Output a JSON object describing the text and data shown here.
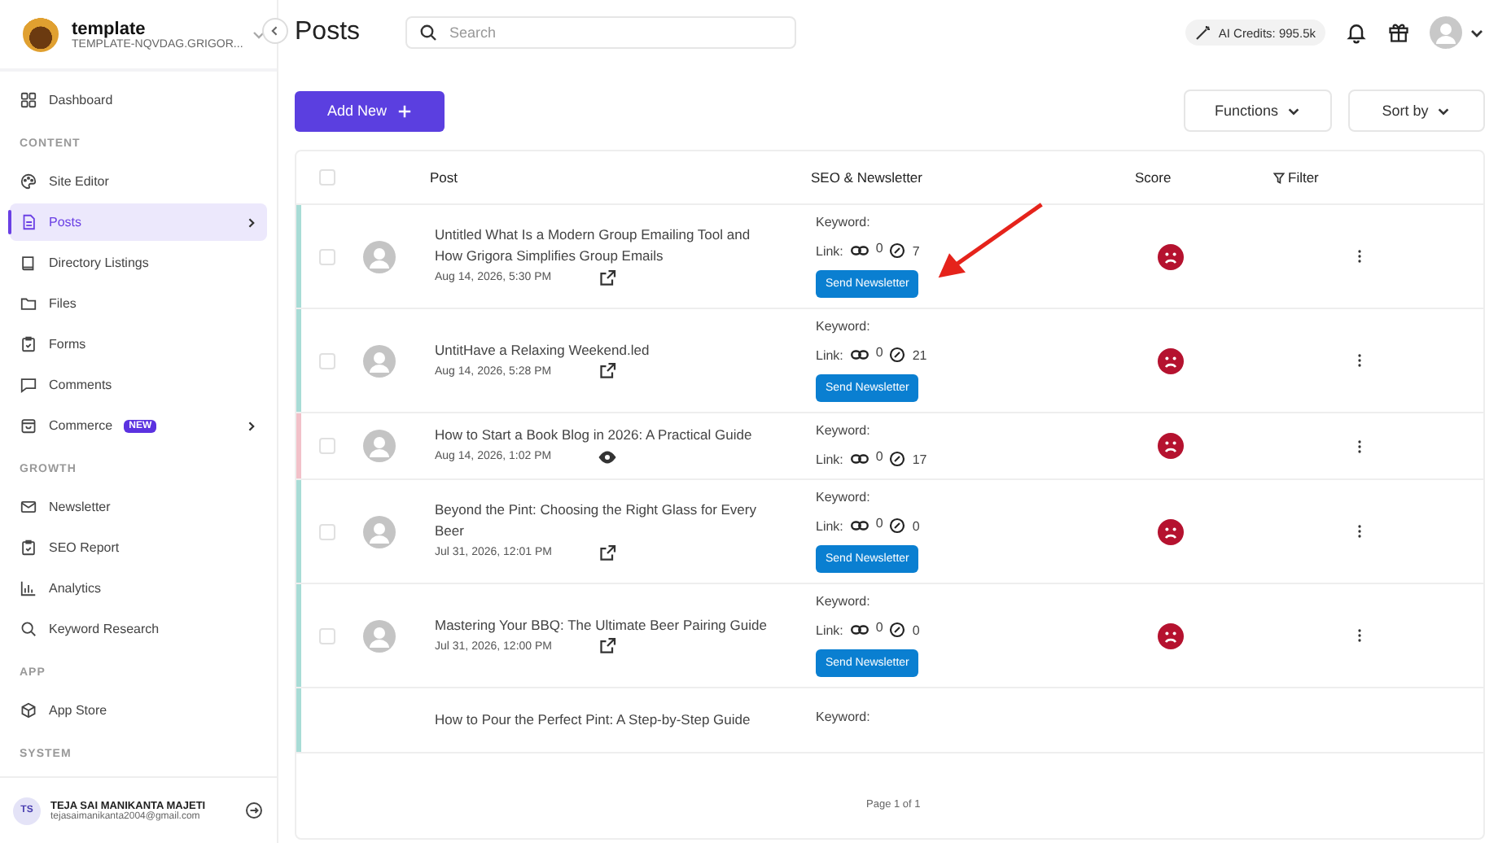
{
  "workspace": {
    "name": "template",
    "domain": "TEMPLATE-NQVDAG.GRIGOR..."
  },
  "sidebar": {
    "sections": [
      {
        "items": [
          {
            "label": "Dashboard",
            "selected": false
          }
        ]
      },
      {
        "heading": "CONTENT",
        "items": [
          {
            "label": "Site Editor",
            "selected": false
          },
          {
            "label": "Posts",
            "selected": true,
            "chevron": true
          },
          {
            "label": "Directory Listings",
            "selected": false
          },
          {
            "label": "Files",
            "selected": false
          },
          {
            "label": "Forms",
            "selected": false
          },
          {
            "label": "Comments",
            "selected": false
          },
          {
            "label": "Commerce",
            "selected": false,
            "badge": "NEW",
            "chevron": true
          }
        ]
      },
      {
        "heading": "GROWTH",
        "items": [
          {
            "label": "Newsletter",
            "selected": false
          },
          {
            "label": "SEO Report",
            "selected": false
          },
          {
            "label": "Analytics",
            "selected": false
          },
          {
            "label": "Keyword Research",
            "selected": false
          }
        ]
      },
      {
        "heading": "APP",
        "items": [
          {
            "label": "App Store",
            "selected": false
          }
        ]
      },
      {
        "heading": "SYSTEM"
      }
    ]
  },
  "user": {
    "initials": "TS",
    "name": "TEJA SAI MANIKANTA MAJETI",
    "email": "tejasaimanikanta2004@gmail.com"
  },
  "header": {
    "title": "Posts",
    "search": {
      "placeholder": "Search"
    },
    "credits": "AI Credits: 995.5k"
  },
  "toolbar": {
    "add_button": "Add New",
    "buttons": [
      "Functions",
      "Sort by"
    ]
  },
  "table": {
    "select_all_checked": false,
    "columns": [
      "Post",
      "SEO & Newsletter",
      "Score",
      "Filter"
    ],
    "rows": [
      {
        "title": "Untitled What Is a Modern Group Emailing Tool and How Grigora Simplifies Group Emails",
        "date": "Aug 14, 2026, 5:30 PM",
        "kind": "external",
        "color": "#a8dcd6",
        "checked": false,
        "keyword": "Keyword:",
        "link_label": "Link:",
        "links": "0",
        "score_count": "7",
        "newsletter": "Send Newsletter"
      },
      {
        "title": "UntitHave a Relaxing Weekend.led",
        "date": "Aug 14, 2026, 5:28 PM",
        "kind": "external",
        "color": "#a8dcd6",
        "checked": false,
        "keyword": "Keyword:",
        "link_label": "Link:",
        "links": "0",
        "score_count": "21",
        "newsletter": "Send Newsletter"
      },
      {
        "title": "How to Start a Book Blog in 2026: A Practical Guide",
        "date": "Aug 14, 2026, 1:02 PM",
        "kind": "view",
        "color": "#f2c1c9",
        "checked": false,
        "keyword": "Keyword:",
        "link_label": "Link:",
        "links": "0",
        "score_count": "17"
      },
      {
        "title": "Beyond the Pint: Choosing the Right Glass for Every Beer",
        "date": "Jul 31, 2026, 12:01 PM",
        "kind": "external",
        "color": "#a8dcd6",
        "checked": false,
        "keyword": "Keyword:",
        "link_label": "Link:",
        "links": "0",
        "score_count": "0",
        "newsletter": "Send Newsletter"
      },
      {
        "title": "Mastering Your BBQ: The Ultimate Beer Pairing Guide",
        "date": "Jul 31, 2026, 12:00 PM",
        "kind": "external",
        "color": "#a8dcd6",
        "checked": false,
        "keyword": "Keyword:",
        "link_label": "Link:",
        "links": "0",
        "score_count": "0",
        "newsletter": "Send Newsletter"
      }
    ],
    "partial_row": {
      "title": "How to Pour the Perfect Pint: A Step-by-Step Guide",
      "keyword": "Keyword:",
      "color": "#a8dcd6"
    },
    "pagination": "Page 1 of 1"
  }
}
